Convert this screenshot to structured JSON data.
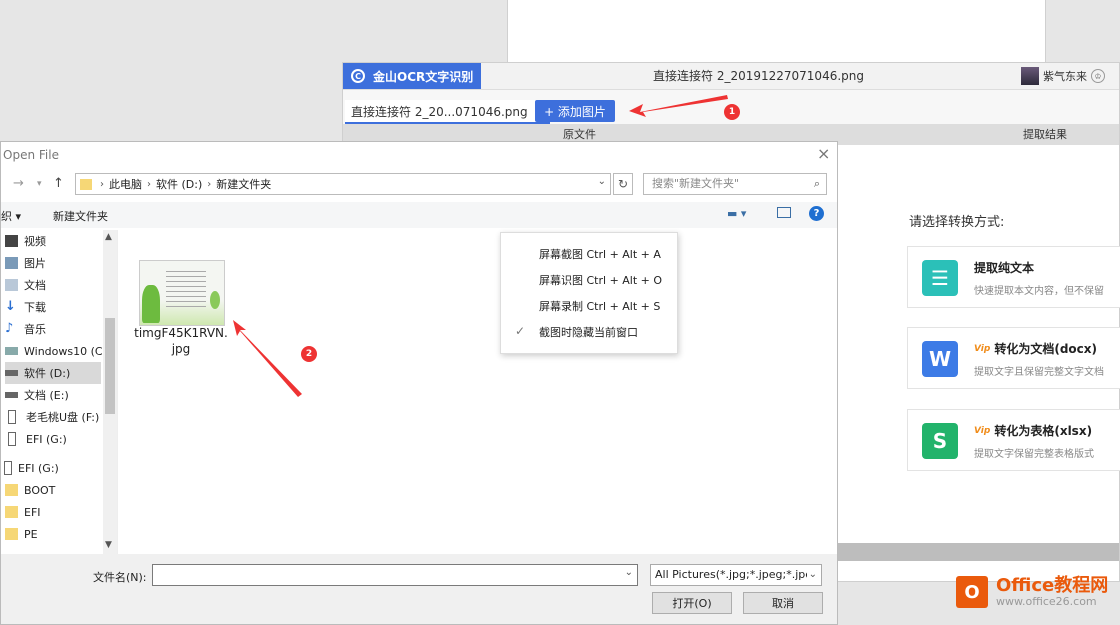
{
  "ocr_app": {
    "brand": "金山OCR文字识别",
    "filename": "直接连接符 2_20191227071046.png",
    "user_name": "紫气东来",
    "tab_label": "直接连接符 2_20...071046.png",
    "tab_close": "×",
    "add_button": "+ 添加图片",
    "col_source": "原文件",
    "col_result": "提取结果",
    "choose_label": "请选择转换方式:",
    "options": [
      {
        "title": "提取纯文本",
        "desc": "快速提取本文内容，但不保留",
        "icon": "T",
        "color": "#2bc0b8",
        "vip": ""
      },
      {
        "title": "转化为文档(docx)",
        "desc": "提取文字且保留完整文字文档",
        "icon": "W",
        "color": "#3d7be6",
        "vip": "Vip"
      },
      {
        "title": "转化为表格(xlsx)",
        "desc": "提取文字保留完整表格版式",
        "icon": "S",
        "color": "#22b36b",
        "vip": "Vip"
      }
    ]
  },
  "dialog": {
    "title": "Open File",
    "close": "×",
    "breadcrumb": [
      "此电脑",
      "软件 (D:)",
      "新建文件夹"
    ],
    "search_placeholder": "搜索\"新建文件夹\"",
    "organize": "织 ▾",
    "new_folder": "新建文件夹",
    "nav_items": [
      {
        "label": "视频",
        "icon": "video-icon"
      },
      {
        "label": "图片",
        "icon": "pictures-icon"
      },
      {
        "label": "文档",
        "icon": "documents-icon"
      },
      {
        "label": "下载",
        "icon": "download-icon"
      },
      {
        "label": "音乐",
        "icon": "music-icon"
      },
      {
        "label": "Windows10 (C:",
        "icon": "drive-icon"
      },
      {
        "label": "软件 (D:)",
        "icon": "drive-icon"
      },
      {
        "label": "文档 (E:)",
        "icon": "drive-icon"
      },
      {
        "label": "老毛桃U盘 (F:)",
        "icon": "usb-icon"
      },
      {
        "label": "EFI (G:)",
        "icon": "usb-icon"
      },
      {
        "label": "EFI (G:)",
        "icon": "usb-icon"
      },
      {
        "label": "BOOT",
        "icon": "folder-icon"
      },
      {
        "label": "EFI",
        "icon": "folder-icon"
      },
      {
        "label": "PE",
        "icon": "folder-icon"
      }
    ],
    "file_name_line1": "timgF45K1RVN.",
    "file_name_line2": "jpg",
    "filename_label": "文件名(N):",
    "filename_value": "",
    "filter": "All Pictures(*.jpg;*.jpeg;*.jpe;",
    "open_button": "打开(O)",
    "cancel_button": "取消"
  },
  "context_menu": {
    "items": [
      "屏幕截图 Ctrl + Alt + A",
      "屏幕识图 Ctrl + Alt + O",
      "屏幕录制 Ctrl + Alt + S",
      "截图时隐藏当前窗口"
    ],
    "checked_index": 3
  },
  "annotations": {
    "marker1": "1",
    "marker2": "2"
  },
  "watermark": {
    "title": "Office教程网",
    "url": "www.office26.com"
  }
}
